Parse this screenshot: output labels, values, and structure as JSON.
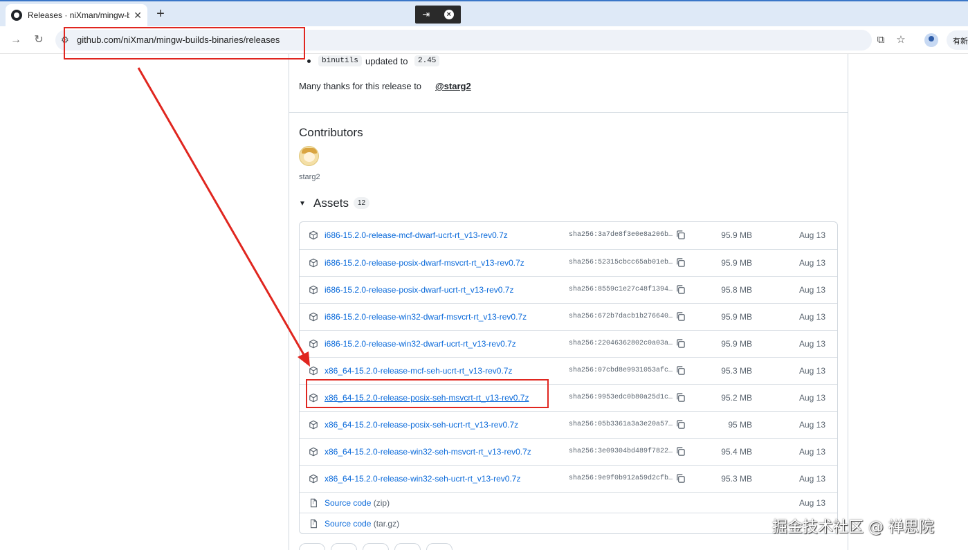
{
  "browser": {
    "tab_title": "Releases · niXman/mingw-bu",
    "tab_close": "✕",
    "new_tab": "+",
    "url": "github.com/niXman/mingw-builds-binaries/releases",
    "update_label": "有新"
  },
  "release_notes": {
    "bullet_code": "binutils",
    "bullet_text": "updated to",
    "bullet_version": "2.45",
    "thanks_text": "Many thanks for this release to",
    "thanks_user": "@starg2"
  },
  "contributors": {
    "heading": "Contributors",
    "user": "starg2"
  },
  "assets": {
    "heading": "Assets",
    "count": "12",
    "items": [
      {
        "name": "i686-15.2.0-release-mcf-dwarf-ucrt-rt_v13-rev0.7z",
        "sha": "sha256:3a7de8f3e0e8a206b…",
        "size": "95.9 MB",
        "date": "Aug 13"
      },
      {
        "name": "i686-15.2.0-release-posix-dwarf-msvcrt-rt_v13-rev0.7z",
        "sha": "sha256:52315cbcc65ab01eb…",
        "size": "95.9 MB",
        "date": "Aug 13"
      },
      {
        "name": "i686-15.2.0-release-posix-dwarf-ucrt-rt_v13-rev0.7z",
        "sha": "sha256:8559c1e27c48f1394…",
        "size": "95.8 MB",
        "date": "Aug 13"
      },
      {
        "name": "i686-15.2.0-release-win32-dwarf-msvcrt-rt_v13-rev0.7z",
        "sha": "sha256:672b7dacb1b276640…",
        "size": "95.9 MB",
        "date": "Aug 13"
      },
      {
        "name": "i686-15.2.0-release-win32-dwarf-ucrt-rt_v13-rev0.7z",
        "sha": "sha256:22046362802c0a03a…",
        "size": "95.9 MB",
        "date": "Aug 13"
      },
      {
        "name": "x86_64-15.2.0-release-mcf-seh-ucrt-rt_v13-rev0.7z",
        "sha": "sha256:07cbd8e9931053afc…",
        "size": "95.3 MB",
        "date": "Aug 13"
      },
      {
        "name": "x86_64-15.2.0-release-posix-seh-msvcrt-rt_v13-rev0.7z",
        "sha": "sha256:9953edc0b80a25d1c…",
        "size": "95.2 MB",
        "date": "Aug 13"
      },
      {
        "name": "x86_64-15.2.0-release-posix-seh-ucrt-rt_v13-rev0.7z",
        "sha": "sha256:05b3361a3a3e20a57…",
        "size": "95 MB",
        "date": "Aug 13"
      },
      {
        "name": "x86_64-15.2.0-release-win32-seh-msvcrt-rt_v13-rev0.7z",
        "sha": "sha256:3e09304bd489f7822…",
        "size": "95.4 MB",
        "date": "Aug 13"
      },
      {
        "name": "x86_64-15.2.0-release-win32-seh-ucrt-rt_v13-rev0.7z",
        "sha": "sha256:9e9f0b912a59d2cfb…",
        "size": "95.3 MB",
        "date": "Aug 13"
      }
    ],
    "source_zip": {
      "label": "Source code",
      "suffix": "(zip)",
      "date": "Aug 13"
    },
    "source_tar": {
      "label": "Source code",
      "suffix": "(tar.gz)",
      "date": ""
    }
  },
  "watermark": "掘金技术社区 @ 禅思院",
  "colors": {
    "link": "#0969da",
    "annotation": "#e0261f",
    "tab_strip": "#dee9f7"
  }
}
